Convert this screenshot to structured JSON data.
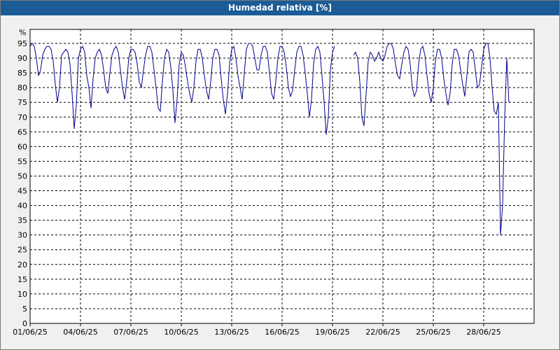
{
  "window": {
    "title": "Humedad relativa [%]"
  },
  "colors": {
    "title_bar": "#1b5c96",
    "series": "#00008b",
    "grid": "#000000",
    "plot_bg": "#ffffff"
  },
  "chart_data": {
    "type": "line",
    "title": "Humedad relativa [%]",
    "ylabel": "%",
    "ylim": [
      0,
      95
    ],
    "yticks": [
      0,
      5,
      10,
      15,
      20,
      25,
      30,
      35,
      40,
      45,
      50,
      55,
      60,
      65,
      70,
      75,
      80,
      85,
      90,
      95
    ],
    "xlim_days": [
      1,
      31
    ],
    "xticks": [
      "01/06/25",
      "04/06/25",
      "07/06/25",
      "10/06/25",
      "13/06/25",
      "16/06/25",
      "19/06/25",
      "22/06/25",
      "25/06/25",
      "28/06/25"
    ],
    "grid": true,
    "legend": "none",
    "series": [
      {
        "x_start": "01/06/25 00:00",
        "x_step_hours": 3,
        "gap_hours_note": "null = no data",
        "values": [
          94,
          95,
          94,
          90,
          84,
          86,
          91,
          93,
          94,
          94,
          93,
          89,
          81,
          75,
          80,
          91,
          92,
          93,
          92,
          88,
          78,
          66,
          74,
          90,
          93,
          94,
          92,
          84,
          80,
          73,
          83,
          90,
          92,
          93,
          91,
          86,
          80,
          78,
          85,
          91,
          93,
          94,
          92,
          86,
          80,
          76,
          82,
          90,
          93,
          93,
          92,
          88,
          82,
          80,
          86,
          91,
          94,
          94,
          92,
          86,
          80,
          73,
          72,
          82,
          90,
          93,
          92,
          87,
          79,
          68,
          76,
          88,
          92,
          91,
          87,
          82,
          78,
          75,
          80,
          89,
          93,
          93,
          90,
          84,
          79,
          76,
          82,
          90,
          93,
          93,
          91,
          83,
          76,
          71,
          78,
          88,
          93,
          94,
          90,
          84,
          80,
          76,
          85,
          93,
          95,
          95,
          94,
          90,
          86,
          86,
          91,
          94,
          94,
          92,
          85,
          78,
          76,
          82,
          90,
          94,
          94,
          92,
          87,
          80,
          77,
          79,
          86,
          92,
          94,
          94,
          91,
          85,
          78,
          70,
          76,
          88,
          93,
          94,
          92,
          84,
          75,
          64,
          70,
          86,
          92,
          94,
          null,
          null,
          null,
          null,
          null,
          null,
          null,
          null,
          91,
          92,
          90,
          82,
          70,
          67,
          78,
          89,
          92,
          91,
          89,
          90,
          92,
          90,
          89,
          91,
          94,
          95,
          95,
          93,
          88,
          84,
          83,
          88,
          92,
          94,
          93,
          88,
          80,
          77,
          79,
          88,
          93,
          94,
          91,
          84,
          78,
          75,
          80,
          89,
          93,
          93,
          90,
          83,
          78,
          74,
          78,
          88,
          93,
          93,
          91,
          86,
          81,
          77,
          84,
          92,
          93,
          92,
          86,
          80,
          81,
          87,
          93,
          95,
          95,
          90,
          80,
          72,
          71,
          75,
          30,
          40,
          70,
          90,
          75
        ]
      }
    ]
  }
}
